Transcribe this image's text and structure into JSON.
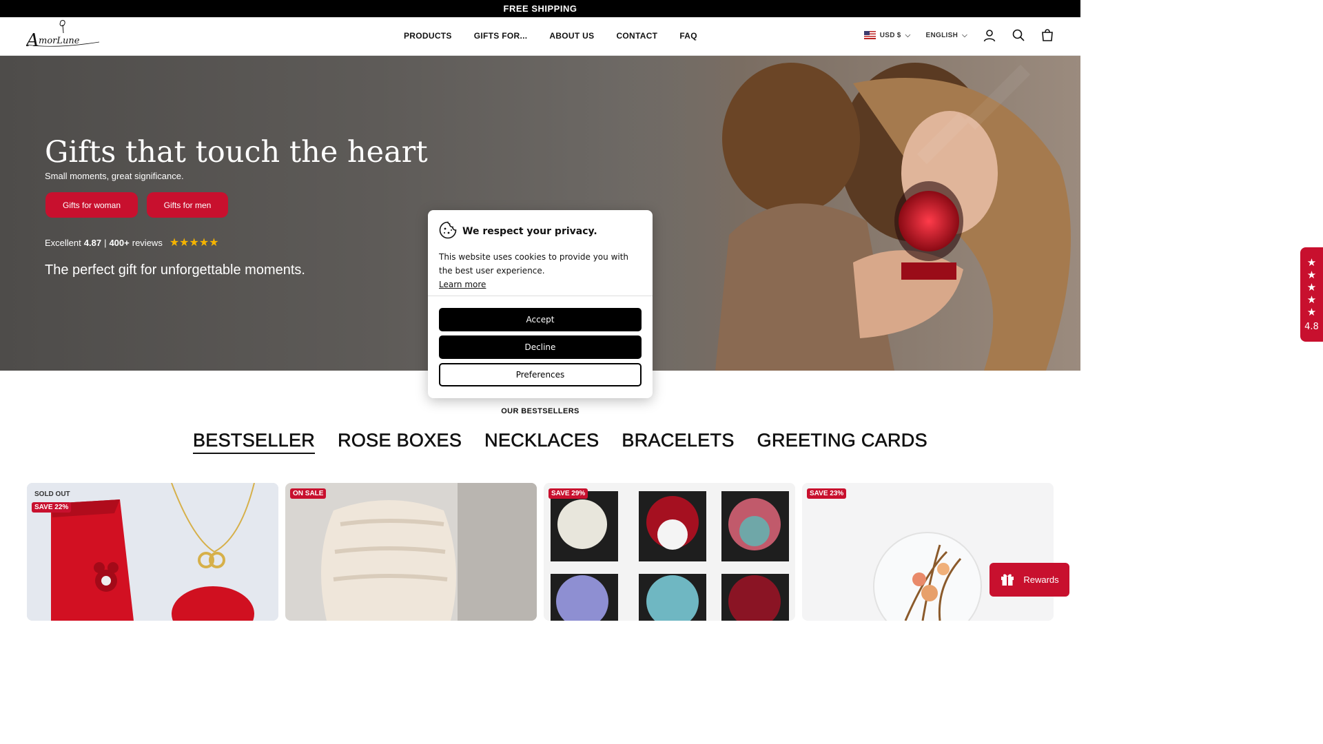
{
  "announcement": "FREE SHIPPING",
  "brand": {
    "logo_text": "AmorLune",
    "accent_color": "#c8102e"
  },
  "nav": [
    "PRODUCTS",
    "GIFTS FOR...",
    "ABOUT US",
    "CONTACT",
    "FAQ"
  ],
  "header": {
    "currency": "USD $",
    "language": "ENGLISH",
    "icons": [
      "account-icon",
      "search-icon",
      "cart-icon"
    ]
  },
  "hero": {
    "title": "Gifts that touch the heart",
    "subtitle": "Small moments, great significance.",
    "buttons": [
      "Gifts for woman",
      "Gifts for men"
    ],
    "rating_prefix": "Excellent",
    "rating_value": "4.87",
    "rating_sep": "|",
    "reviews": "400+",
    "reviews_suffix": "reviews",
    "stars": "★★★★★",
    "tagline": "The perfect gift for unforgettable moments."
  },
  "side_rating": {
    "stars": [
      "★",
      "★",
      "★",
      "★",
      "★"
    ],
    "value": "4.8"
  },
  "cookie": {
    "title": "We respect your privacy.",
    "body": "This website uses cookies to provide you with the best user experience.",
    "link": "Learn more",
    "accept": "Accept",
    "decline": "Decline",
    "preferences": "Preferences"
  },
  "bestsellers": {
    "label": "OUR BESTSELLERS",
    "tabs": [
      "BESTSELLER",
      "ROSE BOXES",
      "NECKLACES",
      "BRACELETS",
      "GREETING CARDS"
    ],
    "active_tab": 0
  },
  "products": [
    {
      "badges": [
        "SOLD OUT",
        "SAVE 22%"
      ]
    },
    {
      "badges": [
        "ON SALE"
      ]
    },
    {
      "badges": [
        "SAVE 29%"
      ]
    },
    {
      "badges": [
        "SAVE 23%"
      ]
    }
  ],
  "rewards": {
    "label": "Rewards"
  }
}
